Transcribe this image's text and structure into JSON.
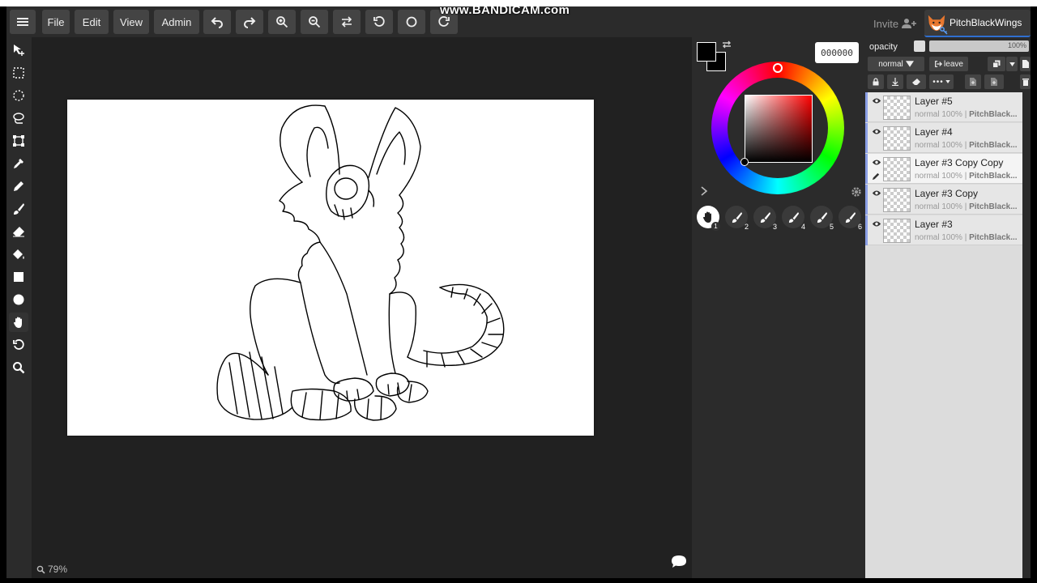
{
  "watermark": "www.BANDICAM.com",
  "menu": {
    "file": "File",
    "edit": "Edit",
    "view": "View",
    "admin": "Admin"
  },
  "toolbar_tools": [
    "move-tool",
    "rect-select-tool",
    "ellipse-select-tool",
    "lasso-tool",
    "transform-tool",
    "eyedropper-tool",
    "pen-tool",
    "brush-tool",
    "eraser-tool",
    "fill-tool",
    "rectangle-tool",
    "ellipse-tool",
    "hand-tool",
    "rotate-tool",
    "zoom-tool"
  ],
  "canvas": {
    "zoom": "79%"
  },
  "color": {
    "hex": "000000",
    "primary": "#000000",
    "secondary": "#000000",
    "ring_handle_hue": "#ff0000"
  },
  "brush_slots": [
    "1",
    "2",
    "3",
    "4",
    "5",
    "6"
  ],
  "header": {
    "invite": "Invite",
    "username": "PitchBlackWings"
  },
  "layer_props": {
    "opacity_label": "opacity",
    "opacity_value": "100%",
    "blend_mode": "normal",
    "leave": "leave"
  },
  "layers": [
    {
      "name": "Layer #5",
      "mode": "normal",
      "opacity": "100%",
      "owner": "PitchBlack..."
    },
    {
      "name": "Layer #4",
      "mode": "normal",
      "opacity": "100%",
      "owner": "PitchBlack..."
    },
    {
      "name": "Layer #3 Copy Copy",
      "mode": "normal",
      "opacity": "100%",
      "owner": "PitchBlack..."
    },
    {
      "name": "Layer #3 Copy",
      "mode": "normal",
      "opacity": "100%",
      "owner": "PitchBlack..."
    },
    {
      "name": "Layer #3",
      "mode": "normal",
      "opacity": "100%",
      "owner": "PitchBlack..."
    }
  ]
}
